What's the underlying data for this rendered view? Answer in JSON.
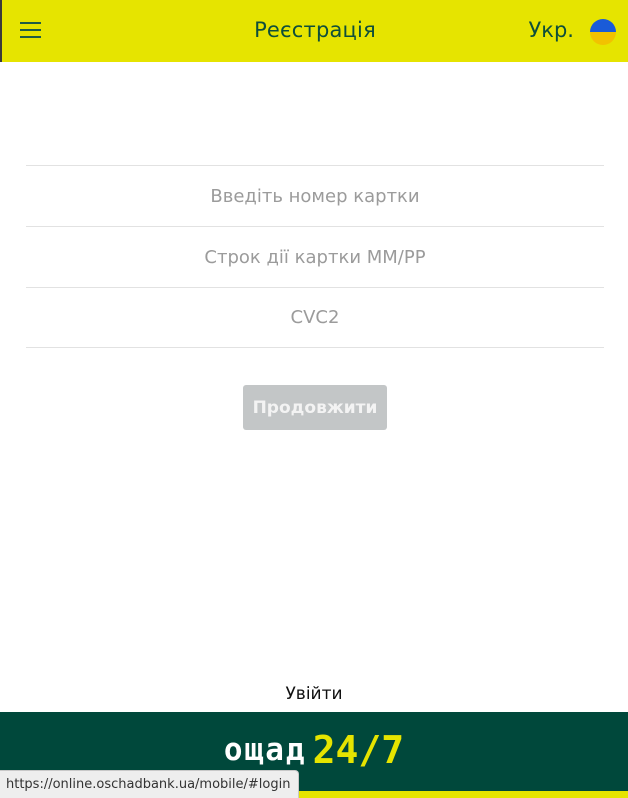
{
  "header": {
    "title": "Реєстрація",
    "language": "Укр.",
    "menu_icon": "hamburger-menu-icon",
    "flag_icon": "ukraine-flag-icon",
    "colors": {
      "background": "#e6e400",
      "text": "#0e4e3a"
    }
  },
  "form": {
    "card_number_placeholder": "Введіть номер картки",
    "card_expiry_placeholder": "Строк дії картки ММ/РР",
    "cvc_placeholder": "CVC2",
    "card_number_value": "",
    "card_expiry_value": "",
    "cvc_value": ""
  },
  "actions": {
    "continue_label": "Продовжити",
    "continue_disabled": true,
    "login_label": "Увійти"
  },
  "footer": {
    "logo_word": "ощад",
    "logo_number": "24/7",
    "colors": {
      "background": "#00483b",
      "accent": "#e6e400"
    }
  },
  "status_bar": {
    "url": "https://online.oschadbank.ua/mobile/#login"
  }
}
